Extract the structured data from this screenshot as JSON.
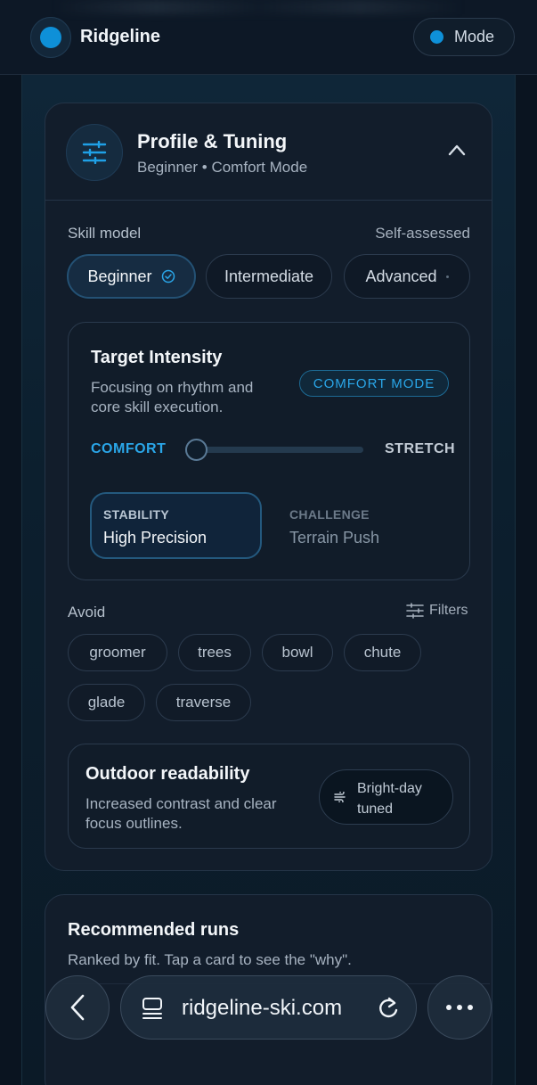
{
  "header": {
    "brand": "Ridgeline",
    "mode_label": "Mode"
  },
  "profile": {
    "title": "Profile & Tuning",
    "subtitle": "Beginner • Comfort Mode",
    "skill_label": "Skill model",
    "skill_meta": "Self-assessed",
    "skills": [
      {
        "label": "Beginner",
        "selected": true
      },
      {
        "label": "Intermediate",
        "selected": false
      },
      {
        "label": "Advanced",
        "selected": false
      }
    ]
  },
  "intensity": {
    "title": "Target Intensity",
    "description": "Focusing on rhythm and core skill execution.",
    "badge": "COMFORT MODE",
    "left_label": "COMFORT",
    "right_label": "STRETCH",
    "level": 0.05,
    "stability_label": "STABILITY",
    "stability_value": "High Precision",
    "challenge_label": "CHALLENGE",
    "challenge_value": "Terrain Push"
  },
  "avoid": {
    "label": "Avoid",
    "filters_label": "Filters",
    "chips": [
      "groomer",
      "trees",
      "bowl",
      "chute",
      "glade",
      "traverse"
    ]
  },
  "outdoor": {
    "title": "Outdoor readability",
    "description": "Increased contrast and clear focus outlines.",
    "pill": "Bright-day tuned"
  },
  "recommended": {
    "title": "Recommended runs",
    "subtitle": "Ranked by fit. Tap a card to see the \"why\"."
  },
  "browser": {
    "url": "ridgeline-ski.com"
  },
  "colors": {
    "accent": "#0e90d8",
    "accent_text": "#2aa6e8",
    "background": "#0a1420",
    "card": "#121d2b"
  },
  "icons": {
    "logo": "brand-dot-icon",
    "tune": "sliders-icon",
    "collapse": "chevron-up-icon",
    "check": "check-circle-icon",
    "filters": "filter-sliders-icon",
    "bright": "wind-icon",
    "back": "back-chevron-icon",
    "tabs": "tabs-icon",
    "reload": "reload-icon",
    "more": "more-dots-icon"
  }
}
